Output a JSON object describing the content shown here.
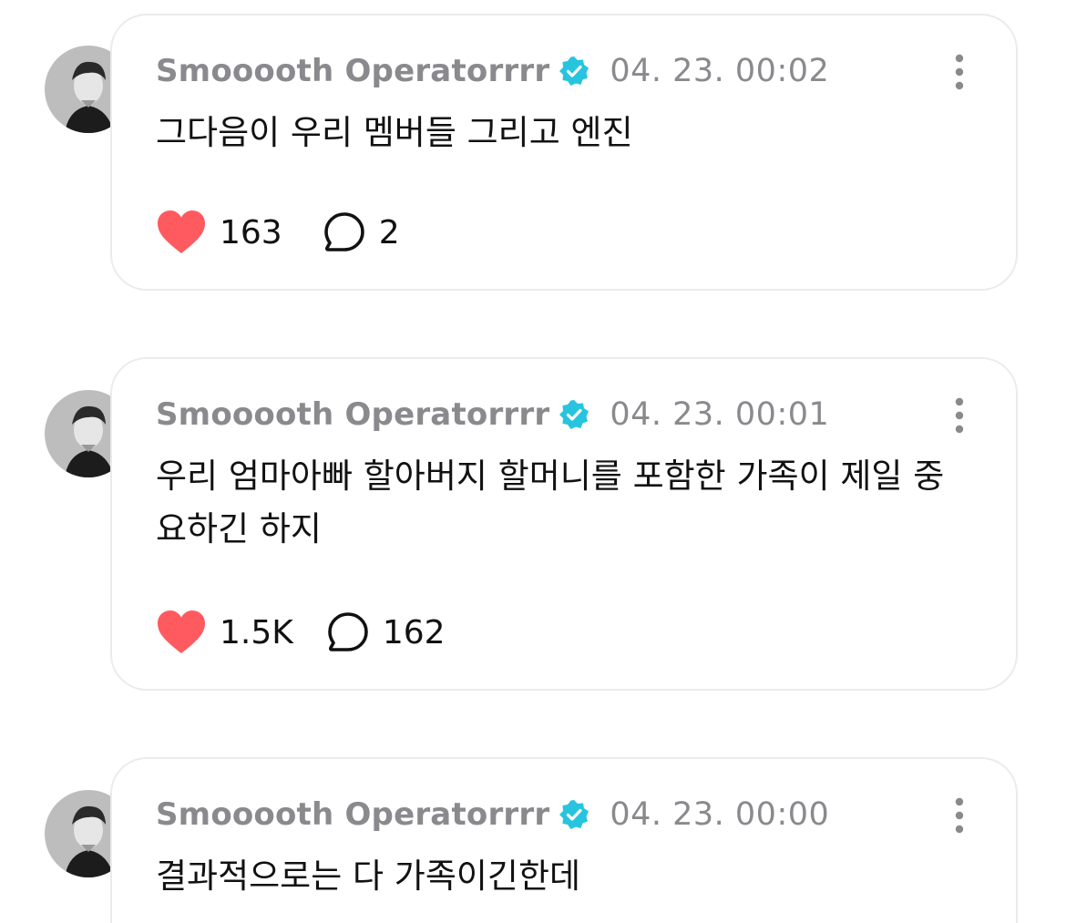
{
  "posts": [
    {
      "author": "Smooooth Operatorrrr",
      "timestamp": "04. 23. 00:02",
      "text": "그다음이 우리 멤버들 그리고 엔진",
      "likes": "163",
      "replies": "2"
    },
    {
      "author": "Smooooth Operatorrrr",
      "timestamp": "04. 23. 00:01",
      "text": "우리 엄마아빠 할아버지 할머니를 포함한 가족이 제일 중요하긴 하지",
      "likes": "1.5K",
      "replies": "162"
    },
    {
      "author": "Smooooth Operatorrrr",
      "timestamp": "04. 23. 00:00",
      "text": "결과적으로는 다 가족이긴한데"
    }
  ],
  "icons": {
    "verified": "verified-badge-icon",
    "like": "heart-icon",
    "reply": "speech-bubble-icon",
    "more": "vertical-ellipsis-icon"
  },
  "colors": {
    "like": "#ff5a5f",
    "verified": "#27c4e0",
    "meta_text": "#8a8a8e",
    "card_border": "#ebebef"
  }
}
